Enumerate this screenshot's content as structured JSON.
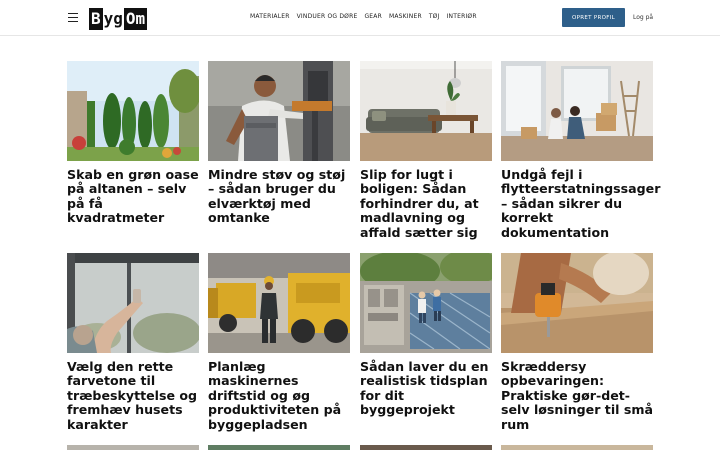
{
  "header": {
    "logo_left": "B",
    "logo_mid": "yg",
    "logo_right": "Om",
    "nav": [
      "MATERIALER",
      "VINDUER OG DØRE",
      "GEAR",
      "MASKINER",
      "TØJ",
      "INTERIØR"
    ],
    "create_profile": "OPRET PROFIL",
    "login": "Log på"
  },
  "articles": [
    {
      "title": "Skab en grøn oase på altanen – selv på få kvadratmeter",
      "image": "garden-terrace-photo"
    },
    {
      "title": "Mindre støv og støj – sådan bruger du elværktøj med omtanke",
      "image": "worker-drill-press-photo"
    },
    {
      "title": "Slip for lugt i boligen: Sådan forhindrer du, at madlavning og affald sætter sig",
      "image": "living-room-sofa-photo"
    },
    {
      "title": "Undgå fejl i flytteerstatningssager – sådan sikrer du korrekt dokumentation",
      "image": "couple-moving-boxes-photo"
    },
    {
      "title": "Vælg den rette farvetone til træbeskyttelse og fremhæv husets karakter",
      "image": "window-cleaning-photo"
    },
    {
      "title": "Planlæg maskinernes driftstid og øg produktiviteten på byggepladsen",
      "image": "yellow-machinery-worker-photo"
    },
    {
      "title": "Sådan laver du en realistisk tidsplan for dit byggeprojekt",
      "image": "construction-site-aerial-photo"
    },
    {
      "title": "Skræddersy opbevaringen: Praktiske gør-det-selv løsninger til små rum",
      "image": "woodworking-drill-photo"
    }
  ]
}
